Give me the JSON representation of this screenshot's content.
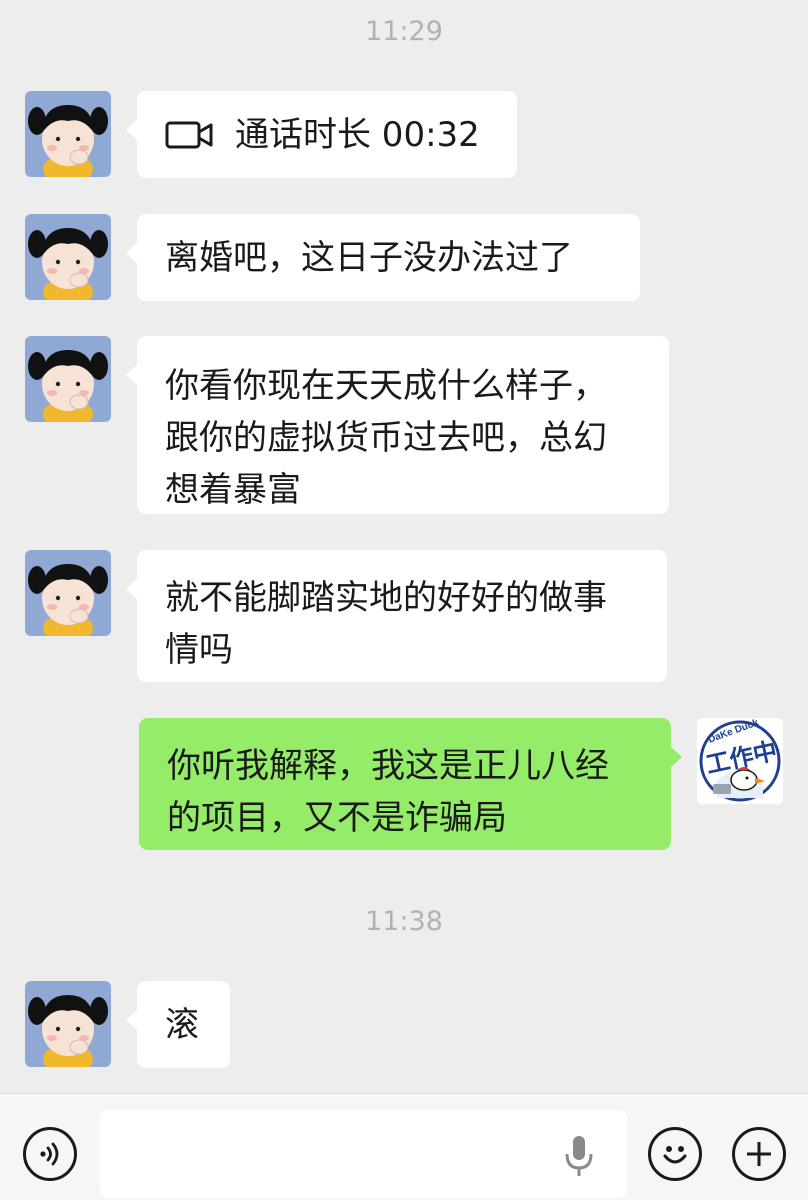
{
  "timestamps": [
    "11:29",
    "11:38"
  ],
  "messages": [
    {
      "sender": "other",
      "type": "video-call",
      "text": "通话时长 00:32"
    },
    {
      "sender": "other",
      "type": "text",
      "text": "离婚吧，这日子没办法过了"
    },
    {
      "sender": "other",
      "type": "text",
      "lines": [
        "你看你现在天天成什么样子，",
        "跟你的虚拟货币过去吧，总幻",
        "想着暴富"
      ]
    },
    {
      "sender": "other",
      "type": "text",
      "lines": [
        "就不能脚踏实地的好好的做事",
        "情吗"
      ]
    },
    {
      "sender": "self",
      "type": "text",
      "lines": [
        "你听我解释，我这是正儿八经",
        "的项目，又不是诈骗局"
      ]
    },
    {
      "sender": "other",
      "type": "text",
      "text": "滚"
    }
  ],
  "self_avatar": {
    "badge_text": "工作中",
    "brand_text": "DaKe Duck"
  },
  "input_bar": {
    "value": "",
    "icons": [
      "voice-icon",
      "microphone-icon",
      "emoji-icon",
      "plus-icon"
    ]
  },
  "colors": {
    "background": "#ededed",
    "bubble_other": "#ffffff",
    "bubble_self": "#95ec69",
    "timestamp": "#b2b2b2"
  }
}
